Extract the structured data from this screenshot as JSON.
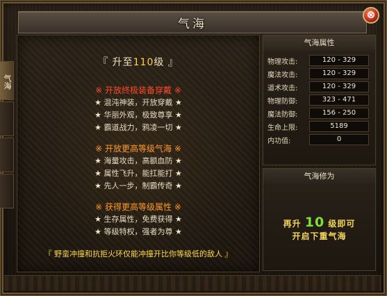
{
  "window": {
    "title": "气海",
    "close_label": "⊗"
  },
  "tabs": [
    {
      "label": "气海",
      "active": true
    },
    {
      "label": "",
      "active": false
    },
    {
      "label": "",
      "active": false
    },
    {
      "label": "",
      "active": false
    }
  ],
  "main": {
    "level_prefix": "『   升至",
    "level_num": "110",
    "level_suffix": "级   』",
    "sections": [
      {
        "header": "开放终极装备穿戴",
        "color": "red",
        "lines": [
          "混沌神装，开放穿戴",
          "华丽外观，极致尊享",
          "霸道战力，鸦凌一切"
        ]
      },
      {
        "header": "开放更高等级气海",
        "color": "orange",
        "lines": [
          "海量攻击，高额血防",
          "属性飞升，能扛能打",
          "先人一步，制霸传奇"
        ]
      },
      {
        "header": "获得更高等级属性",
        "color": "orange",
        "lines": [
          "生存属性，免费获得",
          "等级特权，强者为尊"
        ]
      }
    ],
    "bottom_note": "『 野蛮冲撞和抗拒火环仅能冲撞开比你等级低的敌人 』"
  },
  "attributes": {
    "header": "气海属性",
    "rows": [
      {
        "label": "物理攻击:",
        "value": "120 - 329"
      },
      {
        "label": "魔法攻击:",
        "value": "120 - 329"
      },
      {
        "label": "道术攻击:",
        "value": "120 - 329"
      },
      {
        "label": "物理防御:",
        "value": "323 - 471"
      },
      {
        "label": "魔法防御:",
        "value": "156 - 250"
      },
      {
        "label": "生命上限:",
        "value": "5189"
      },
      {
        "label": "内功值:",
        "value": "0"
      }
    ]
  },
  "cultivation": {
    "header": "气海修为",
    "line1_prefix": "再升",
    "line1_num": "10",
    "line1_suffix": "级即可",
    "line2": "开启下重气海"
  }
}
